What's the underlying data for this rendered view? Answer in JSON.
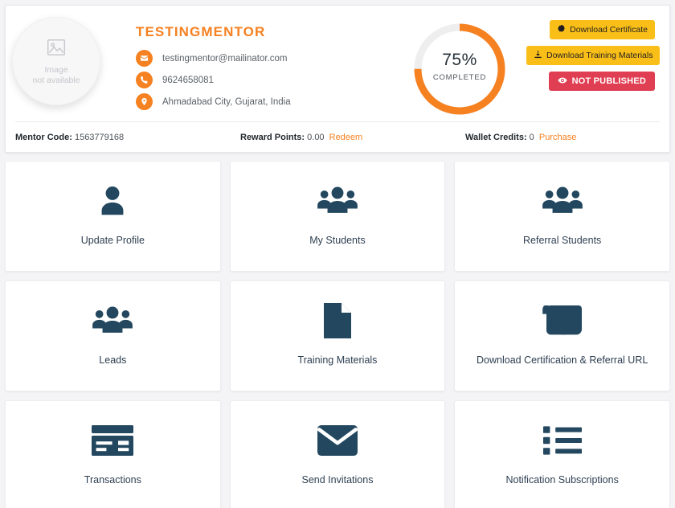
{
  "profile": {
    "avatar": {
      "icon": "image-placeholder-icon",
      "line1": "Image",
      "line2": "not available"
    },
    "name": "TESTINGMENTOR",
    "contacts": [
      {
        "icon": "envelope-icon",
        "value": "testingmentor@mailinator.com"
      },
      {
        "icon": "phone-icon",
        "value": "9624658081"
      },
      {
        "icon": "location-pin-icon",
        "value": "Ahmadabad City, Gujarat, India"
      }
    ],
    "progress": {
      "percent_label": "75%",
      "percent_value": 75,
      "caption": "COMPLETED",
      "track_color": "#eeeeee",
      "fill_color": "#f68121"
    },
    "actions": [
      {
        "icon": "certificate-badge-icon",
        "label": "Download Certificate",
        "style": "gold"
      },
      {
        "icon": "download-icon",
        "label": "Download Training Materials",
        "style": "gold"
      },
      {
        "icon": "eye-icon",
        "label": "NOT PUBLISHED",
        "style": "red"
      }
    ]
  },
  "stats": [
    {
      "key": "Mentor Code:",
      "value": "1563779168",
      "link": ""
    },
    {
      "key": "Reward Points:",
      "value": "0.00",
      "link": "Redeem"
    },
    {
      "key": "Wallet Credits:",
      "value": "0",
      "link": "Purchase"
    }
  ],
  "cards": [
    {
      "icon": "user-icon",
      "label": "Update Profile"
    },
    {
      "icon": "users-group-icon",
      "label": "My Students"
    },
    {
      "icon": "users-group-icon",
      "label": "Referral Students"
    },
    {
      "icon": "users-group-icon",
      "label": "Leads"
    },
    {
      "icon": "file-document-icon",
      "label": "Training Materials"
    },
    {
      "icon": "scroll-icon",
      "label": "Download Certification & Referral URL"
    },
    {
      "icon": "credit-card-icon",
      "label": "Transactions"
    },
    {
      "icon": "envelope-solid-icon",
      "label": "Send Invitations"
    },
    {
      "icon": "list-ul-icon",
      "label": "Notification Subscriptions"
    }
  ],
  "colors": {
    "accent_orange": "#f68121",
    "gold": "#f9bf18",
    "danger_red": "#e03e52",
    "icon_navy": "#22475f",
    "page_bg": "#f4f4f6"
  }
}
